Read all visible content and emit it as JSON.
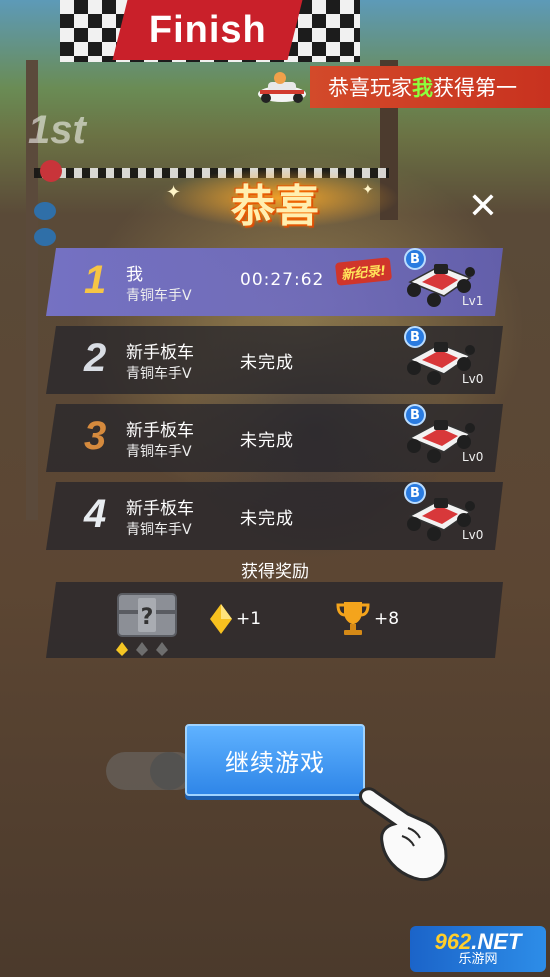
{
  "scene": {
    "finish_text": "Finish",
    "first_mark": "1st"
  },
  "broadcast": {
    "prefix": "恭喜玩家",
    "highlight": "我",
    "suffix": "获得第一"
  },
  "dialog": {
    "title": "恭喜",
    "close_label": "✕"
  },
  "rankings": [
    {
      "rank": "1",
      "name": "我",
      "title": "青铜车手V",
      "status": "00:27:62",
      "new_record": "新纪录!",
      "car_badge": "B",
      "level": "Lv1"
    },
    {
      "rank": "2",
      "name": "新手板车",
      "title": "青铜车手V",
      "status": "未完成",
      "car_badge": "B",
      "level": "Lv0"
    },
    {
      "rank": "3",
      "name": "新手板车",
      "title": "青铜车手V",
      "status": "未完成",
      "car_badge": "B",
      "level": "Lv0"
    },
    {
      "rank": "4",
      "name": "新手板车",
      "title": "青铜车手V",
      "status": "未完成",
      "car_badge": "B",
      "level": "Lv0"
    }
  ],
  "rewards": {
    "title": "获得奖励",
    "chest_icon": "mystery-chest-icon",
    "gem_count": "+1",
    "trophy_count": "+8"
  },
  "continue_button": {
    "label": "继续游戏"
  },
  "watermark": {
    "line1_a": "962",
    "line1_b": ".NET",
    "line2": "乐游网"
  },
  "colors": {
    "accent_blue": "#2f86e8",
    "highlight_row": "#7876d2",
    "gold": "#f6c545",
    "banner_red": "#c8321f"
  }
}
